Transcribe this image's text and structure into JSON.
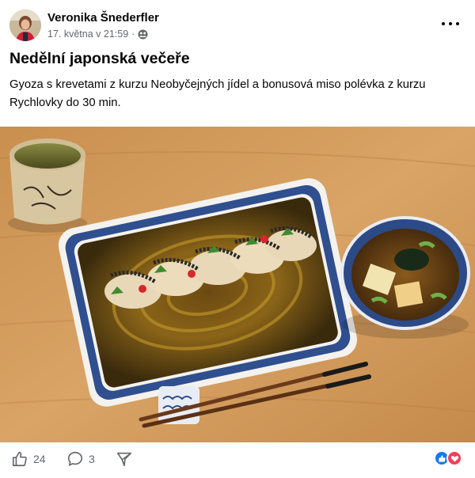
{
  "post": {
    "author": "Veronika Šnederfler",
    "timestamp": "17. května v 21:59",
    "separator": "·",
    "audience_icon": "friends-icon",
    "title": "Nedělní japonská večeře",
    "description": "Gyoza s krevetami z kurzu Neobyčejných jídel a bonusová miso polévka z kurzu Rychlovky do 30 min.",
    "image_alt": "Gyoza s krevetami a miso polévka"
  },
  "footer": {
    "likes_count": "24",
    "comments_count": "3",
    "reactions": [
      "like",
      "love"
    ]
  },
  "colors": {
    "like_blue": "#1877f2",
    "love_red": "#f33e58",
    "secondary_text": "#65676b"
  }
}
